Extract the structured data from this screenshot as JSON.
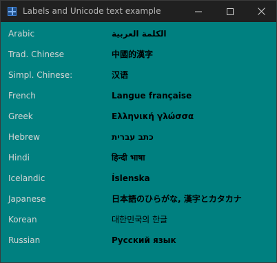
{
  "window": {
    "title": "Labels and Unicode text example",
    "background_color": "#008080",
    "titlebar_color": "#202020",
    "controls": {
      "minimize_icon": "minimize-icon",
      "maximize_icon": "maximize-icon",
      "close_icon": "close-icon"
    }
  },
  "rows": [
    {
      "language": "Arabic",
      "sample": "الكلمة العربية"
    },
    {
      "language": "Trad. Chinese",
      "sample": "中國的漢字"
    },
    {
      "language": "Simpl. Chinese:",
      "sample": "汉语"
    },
    {
      "language": "French",
      "sample": "Langue française"
    },
    {
      "language": "Greek",
      "sample": "Ελληνική γλώσσα"
    },
    {
      "language": "Hebrew",
      "sample": "כתב עברית"
    },
    {
      "language": "Hindi",
      "sample": "हिन्दी भाषा"
    },
    {
      "language": "Icelandic",
      "sample": "Íslenska"
    },
    {
      "language": "Japanese",
      "sample": "日本語のひらがな, 漢字とカタカナ"
    },
    {
      "language": "Korean",
      "sample": "대한민국의 한글"
    },
    {
      "language": "Russian",
      "sample": "Русский язык"
    }
  ]
}
